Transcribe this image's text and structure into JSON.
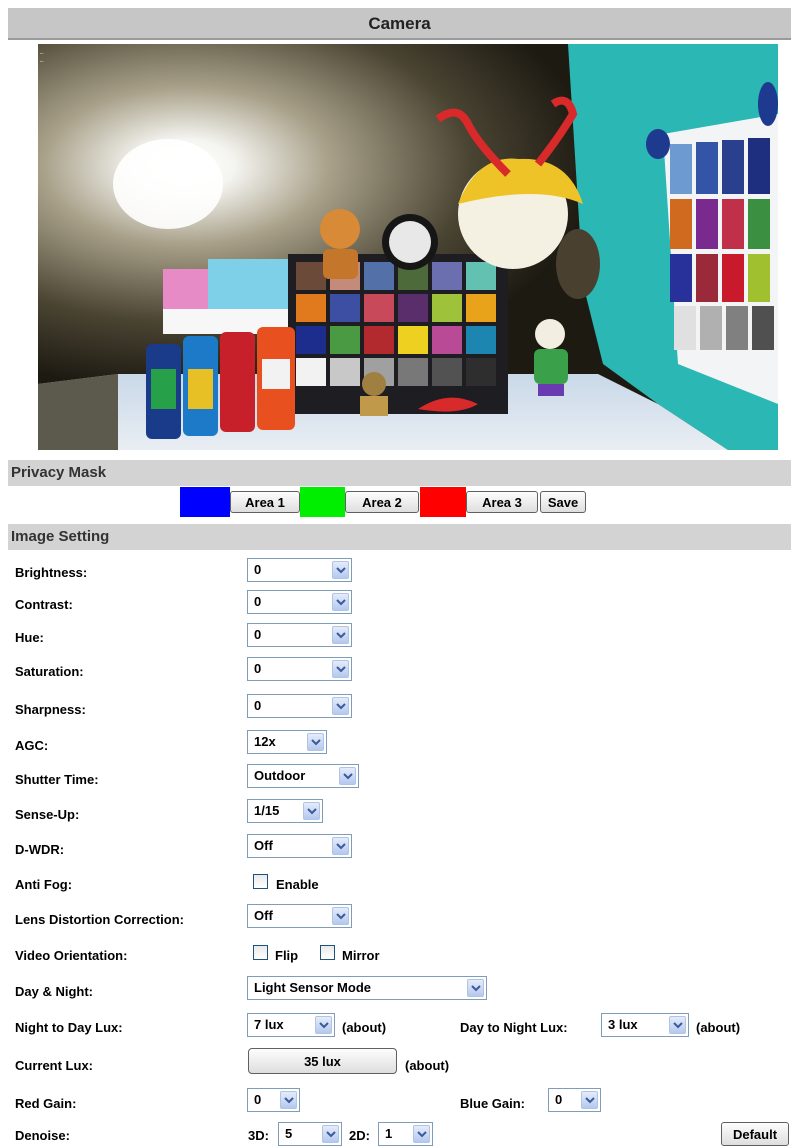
{
  "header": {
    "title": "Camera"
  },
  "preview": {
    "overlay_text_1": "…",
    "overlay_text_2": "…"
  },
  "privacy_mask": {
    "section_title": "Privacy Mask",
    "area1_label": "Area 1",
    "area1_color": "#0000ff",
    "area2_label": "Area 2",
    "area2_color": "#00ee00",
    "area3_label": "Area 3",
    "area3_color": "#ff0000",
    "save_label": "Save"
  },
  "image_setting": {
    "section_title": "Image Setting",
    "brightness": {
      "label": "Brightness:",
      "value": "0"
    },
    "contrast": {
      "label": "Contrast:",
      "value": "0"
    },
    "hue": {
      "label": "Hue:",
      "value": "0"
    },
    "saturation": {
      "label": "Saturation:",
      "value": "0"
    },
    "sharpness": {
      "label": "Sharpness:",
      "value": "0"
    },
    "agc": {
      "label": "AGC:",
      "value": "12x"
    },
    "shutter_time": {
      "label": "Shutter Time:",
      "value": "Outdoor"
    },
    "sense_up": {
      "label": "Sense-Up:",
      "value": "1/15"
    },
    "dwdr": {
      "label": "D-WDR:",
      "value": "Off"
    },
    "anti_fog": {
      "label": "Anti Fog:",
      "enable_label": "Enable",
      "checked": false
    },
    "ldc": {
      "label": "Lens Distortion Correction:",
      "value": "Off"
    },
    "video_orientation": {
      "label": "Video Orientation:",
      "flip_label": "Flip",
      "mirror_label": "Mirror",
      "flip_checked": false,
      "mirror_checked": false
    },
    "day_night": {
      "label": "Day & Night:",
      "value": "Light Sensor Mode"
    },
    "night_to_day": {
      "label": "Night to Day Lux:",
      "value": "7 lux",
      "suffix": "(about)"
    },
    "day_to_night": {
      "label": "Day to Night Lux:",
      "value": "3 lux",
      "suffix": "(about)"
    },
    "current_lux": {
      "label": "Current Lux:",
      "value": "35 lux",
      "suffix": "(about)"
    },
    "red_gain": {
      "label": "Red Gain:",
      "value": "0"
    },
    "blue_gain": {
      "label": "Blue Gain:",
      "value": "0"
    },
    "denoise": {
      "label": "Denoise:",
      "label_3d": "3D:",
      "value_3d": "5",
      "label_2d": "2D:",
      "value_2d": "1"
    },
    "default_label": "Default"
  }
}
